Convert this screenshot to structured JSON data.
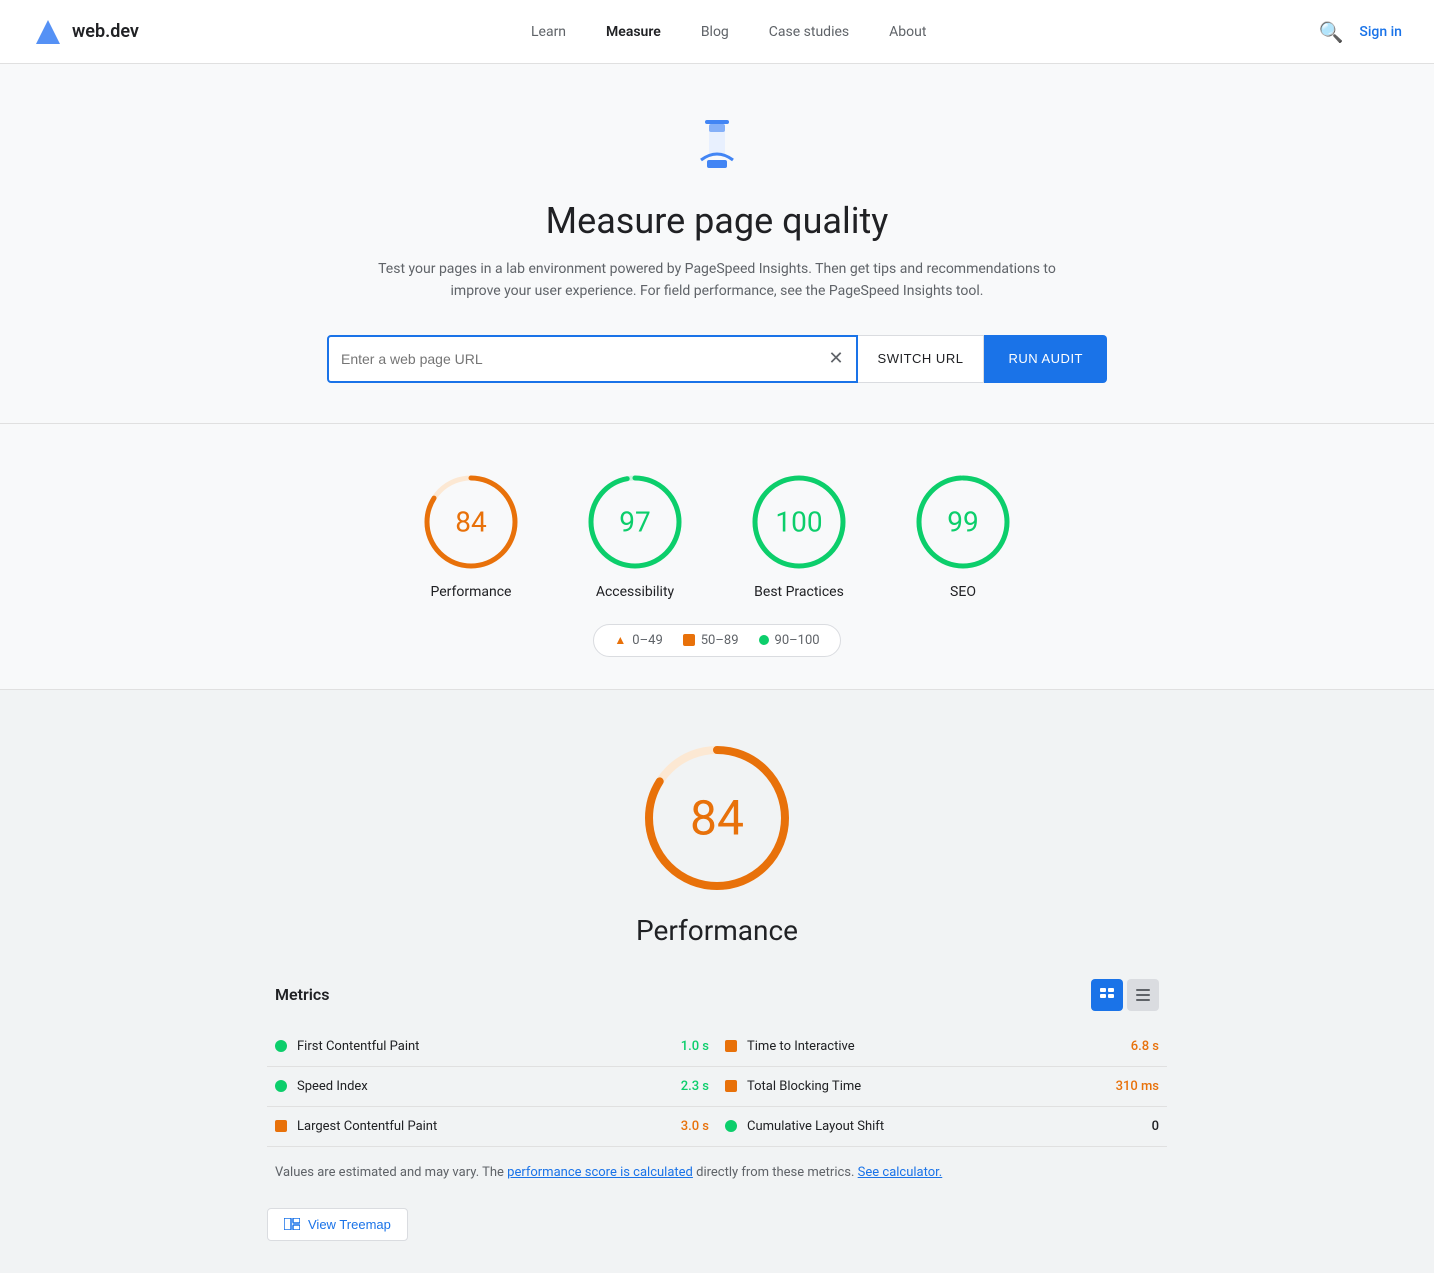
{
  "nav": {
    "logo_text": "web.dev",
    "links": [
      {
        "label": "Learn",
        "active": false
      },
      {
        "label": "Measure",
        "active": true
      },
      {
        "label": "Blog",
        "active": false
      },
      {
        "label": "Case studies",
        "active": false
      },
      {
        "label": "About",
        "active": false
      }
    ],
    "signin_label": "Sign in"
  },
  "hero": {
    "title": "Measure page quality",
    "subtitle": "Test your pages in a lab environment powered by PageSpeed Insights. Then get tips and recommendations to improve your user experience. For field performance, see the PageSpeed Insights tool.",
    "url_placeholder": "Enter a web page URL",
    "switch_url_label": "SWITCH URL",
    "run_audit_label": "RUN AUDIT"
  },
  "scores": [
    {
      "id": "performance",
      "value": 84,
      "label": "Performance",
      "color": "#e8710a",
      "track_color": "#fce8d3"
    },
    {
      "id": "accessibility",
      "value": 97,
      "label": "Accessibility",
      "color": "#0cce6b",
      "track_color": "#c8f5e0"
    },
    {
      "id": "best-practices",
      "value": 100,
      "label": "Best Practices",
      "color": "#0cce6b",
      "track_color": "#c8f5e0"
    },
    {
      "id": "seo",
      "value": 99,
      "label": "SEO",
      "color": "#0cce6b",
      "track_color": "#c8f5e0"
    }
  ],
  "legend": [
    {
      "id": "red",
      "range": "0–49",
      "type": "triangle"
    },
    {
      "id": "orange",
      "range": "50–89",
      "type": "square"
    },
    {
      "id": "green",
      "range": "90–100",
      "type": "circle"
    }
  ],
  "performance_score": {
    "value": 84,
    "label": "Performance"
  },
  "metrics": {
    "title": "Metrics",
    "items_left": [
      {
        "label": "First Contentful Paint",
        "value": "1.0 s",
        "indicator": "dot-green"
      },
      {
        "label": "Speed Index",
        "value": "2.3 s",
        "indicator": "dot-green"
      },
      {
        "label": "Largest Contentful Paint",
        "value": "3.0 s",
        "indicator": "square-orange",
        "value_color": "orange"
      }
    ],
    "items_right": [
      {
        "label": "Time to Interactive",
        "value": "6.8 s",
        "indicator": "square-orange",
        "value_color": "orange"
      },
      {
        "label": "Total Blocking Time",
        "value": "310 ms",
        "indicator": "square-orange",
        "value_color": "orange"
      },
      {
        "label": "Cumulative Layout Shift",
        "value": "0",
        "indicator": "dot-green"
      }
    ],
    "footer_text": "Values are estimated and may vary. The ",
    "footer_link1": "performance score is calculated",
    "footer_middle": " directly from these metrics. ",
    "footer_link2": "See calculator.",
    "treemap_label": "View Treemap"
  }
}
